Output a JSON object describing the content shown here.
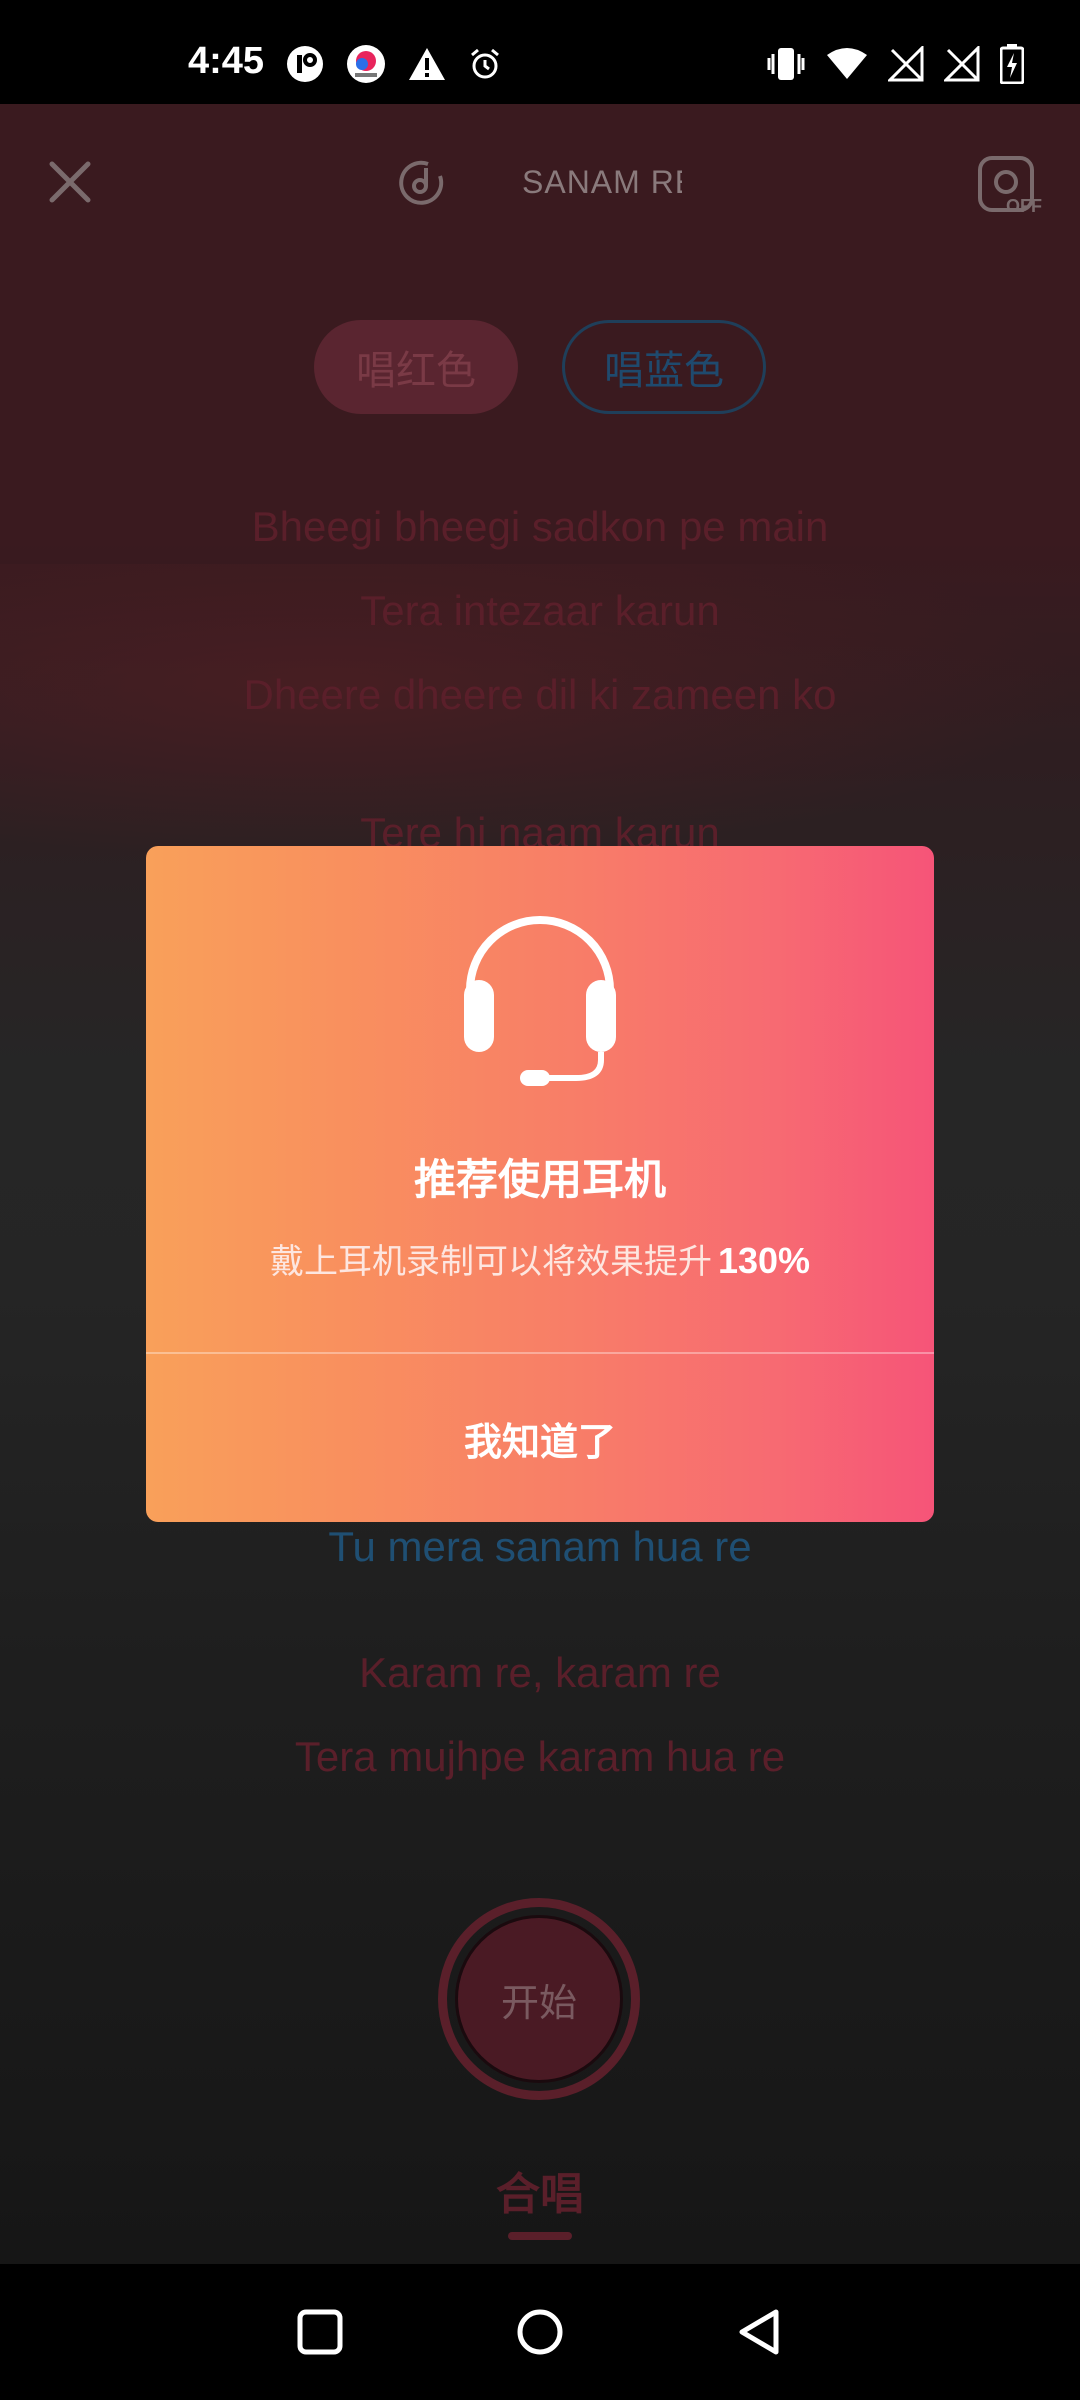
{
  "status": {
    "time": "4:45",
    "left_icons": [
      "info-icon",
      "app-icon",
      "warning-icon",
      "alarm-icon"
    ],
    "right_icons": [
      "vibrate-icon",
      "wifi-icon",
      "no-signal-icon",
      "no-signal-icon",
      "battery-charging-icon"
    ]
  },
  "header": {
    "song_title": "SANAM RE",
    "camera_label": "OFF"
  },
  "parts": {
    "red_label": "唱红色",
    "blue_label": "唱蓝色"
  },
  "lyrics": [
    {
      "text": "Bheegi bheegi sadkon pe main",
      "color": "red"
    },
    {
      "text": "Tera intezaar karun",
      "color": "red"
    },
    {
      "text": "Dheere dheere dil ki zameen ko",
      "color": "red"
    },
    {
      "text": "Tere hi naam karun",
      "color": "red"
    },
    {
      "text": "Tu mera sanam hua re",
      "color": "blue"
    },
    {
      "text": "Karam re, karam re",
      "color": "red"
    },
    {
      "text": "Tera mujhpe karam hua re",
      "color": "red"
    }
  ],
  "controls": {
    "start_label": "开始",
    "mode_label": "合唱"
  },
  "dialog": {
    "title": "推荐使用耳机",
    "message": "戴上耳机录制可以将效果提升",
    "highlight": "130%",
    "confirm_label": "我知道了"
  },
  "colors": {
    "red_part": "#5a1f2a",
    "blue_part": "#1f4f73",
    "dialog_gradient_start": "#f9a05a",
    "dialog_gradient_end": "#f65478"
  }
}
